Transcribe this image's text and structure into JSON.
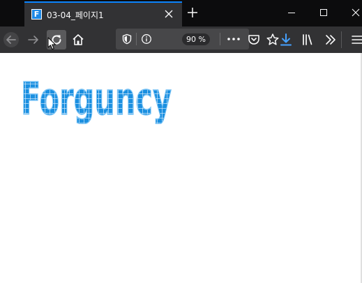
{
  "tab": {
    "title": "03-04_페이지1",
    "favicon_letter": "F"
  },
  "toolbar": {
    "zoom": "90 %"
  },
  "logo": {
    "text": "Forguncy",
    "fill_color": "#1a8fe0",
    "grid_color": "#e8f4ff"
  },
  "colors": {
    "tabstrip": "#0c0c0d",
    "toolbar": "#323234",
    "accent": "#0a84ff",
    "download_accent": "#45a1ff"
  },
  "icons": {
    "back": "arrow-left-icon",
    "forward": "arrow-right-icon",
    "reload": "reload-icon",
    "home": "home-icon",
    "tracking": "shield-icon",
    "site_info": "info-icon",
    "page_actions": "more-horizontal-icon",
    "pocket": "pocket-icon",
    "bookmark": "star-icon",
    "downloads": "download-icon",
    "library": "library-icon",
    "overflow": "chevron-double-right-icon",
    "menu": "hamburger-menu-icon"
  }
}
